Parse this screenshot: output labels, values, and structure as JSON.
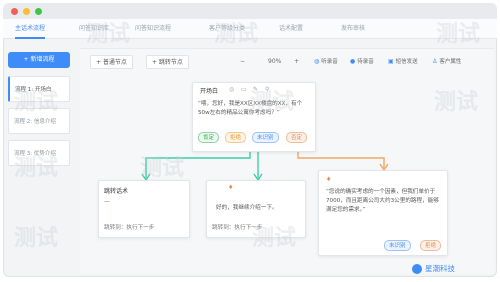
{
  "tabs": [
    {
      "label": "主话术流程"
    },
    {
      "label": "问答知识库"
    },
    {
      "label": "问答知识流程"
    },
    {
      "label": "客户等级分类"
    },
    {
      "label": "话术配置"
    },
    {
      "label": "发布审核"
    }
  ],
  "sidebar": {
    "new_flow": "+ 新增流程",
    "items": [
      {
        "label": "流程 1: 开场白"
      },
      {
        "label": "流程 2: 信息介绍"
      },
      {
        "label": "流程 3: 优势介绍"
      }
    ]
  },
  "toolbar": {
    "add_normal_node": "+ 普通节点",
    "add_jump_node": "+ 跳转节点",
    "zoom_minus": "−",
    "zoom_value": "90%",
    "zoom_plus": "+",
    "tools": [
      {
        "label": "听录音",
        "icon": "headphone-icon"
      },
      {
        "label": "待录音",
        "icon": "mic-icon"
      },
      {
        "label": "短信发送",
        "icon": "message-icon"
      },
      {
        "label": "客户属性",
        "icon": "user-icon"
      }
    ]
  },
  "nodes": {
    "start": {
      "title": "开场白",
      "body": "“喂，您好，我是XX区XX楼盘的XX，有个50w左右的精品公寓你考虑吗？”",
      "chips": [
        {
          "label": "肯定",
          "color": "green"
        },
        {
          "label": "拒绝",
          "color": "orange"
        },
        {
          "label": "未识别",
          "color": "blue"
        },
        {
          "label": "否定",
          "color": "peach"
        }
      ]
    },
    "left": {
      "title": "跳转话术",
      "body": "—",
      "footer": "跳转到：执行下一步"
    },
    "middle": {
      "body": "好的，我继续介绍一下。",
      "footer": "跳转到：执行下一步"
    },
    "right": {
      "body": "“您说的确实考虑的一个因素，但我们单价于7000，而且距离公司大约3公里的路程，能够满足您的需求。”",
      "chips": [
        {
          "label": "未识别",
          "color": "blue"
        },
        {
          "label": "拒绝",
          "color": "peach"
        }
      ]
    }
  },
  "watermarks": [
    "测试",
    "测试",
    "测试",
    "测试",
    "测试",
    "测试",
    "测试",
    "测试",
    "测试",
    "测试"
  ],
  "brand": {
    "name": "星潮科技"
  },
  "colors": {
    "accent": "#3f8bf7",
    "positive": "#3aa757",
    "warning": "#e59b38",
    "negative": "#e58a56",
    "connector": "#3ccfa6",
    "connector_right": "#f2a75f"
  }
}
